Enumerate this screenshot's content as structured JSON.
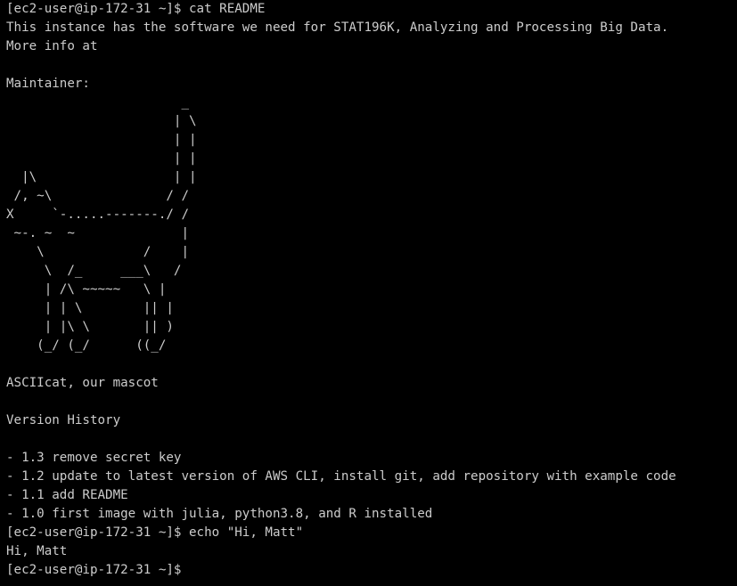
{
  "terminal": {
    "lines": [
      "[ec2-user@ip-172-31 ~]$ cat README",
      "This instance has the software we need for STAT196K, Analyzing and Processing Big Data.",
      "More info at ",
      "",
      "Maintainer:",
      "                       _",
      "                      | \\",
      "                      | |",
      "                      | |",
      "  |\\                  | |",
      " /, ~\\               / /",
      "X     `-.....-------./ /",
      " ~-. ~  ~              |",
      "    \\             /    |",
      "     \\  /_     ___\\   /",
      "     | /\\ ~~~~~   \\ |",
      "     | | \\        || |",
      "     | |\\ \\       || )",
      "    (_/ (_/      ((_/",
      "",
      "ASCIIcat, our mascot",
      "",
      "Version History",
      "",
      "- 1.3 remove secret key",
      "- 1.2 update to latest version of AWS CLI, install git, add repository with example code",
      "- 1.1 add README",
      "- 1.0 first image with julia, python3.8, and R installed",
      "[ec2-user@ip-172-31 ~]$ echo \"Hi, Matt\"",
      "Hi, Matt",
      "[ec2-user@ip-172-31 ~]$ "
    ]
  },
  "colors": {
    "background": "#000000",
    "foreground": "#cccccc"
  }
}
